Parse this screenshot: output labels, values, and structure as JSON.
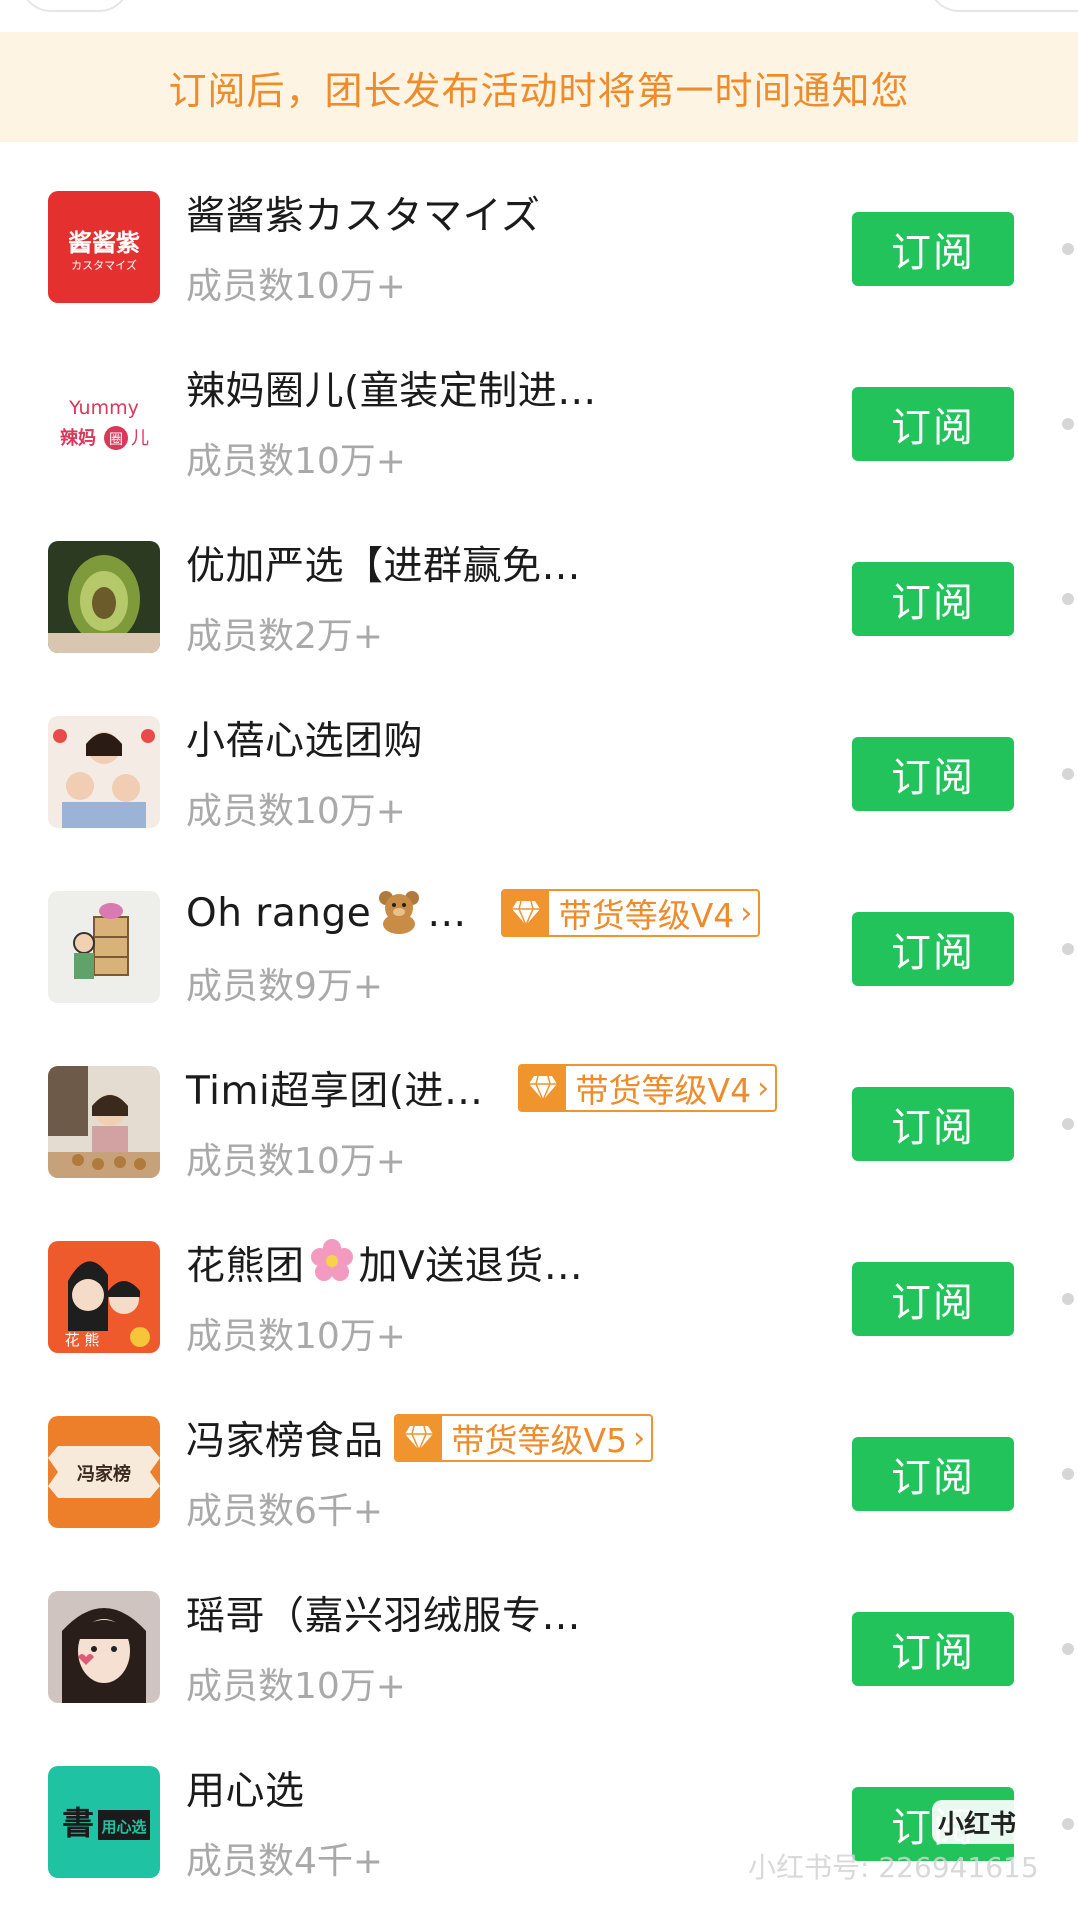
{
  "notice": {
    "text": "订阅后，团长发布活动时将第一时间通知您"
  },
  "groups": [
    {
      "name": "酱酱紫カスタマイズ",
      "members": "成员数10万+",
      "subscribe": "订阅",
      "avatar": "jiangjiangzi-logo",
      "badge": null
    },
    {
      "name": "辣妈圈儿(童装定制进…",
      "members": "成员数10万+",
      "subscribe": "订阅",
      "avatar": "yummy-lamaquaner-logo",
      "badge": null
    },
    {
      "name": "优加严选【进群赢免…",
      "members": "成员数2万+",
      "subscribe": "订阅",
      "avatar": "avocado-carving-photo",
      "badge": null
    },
    {
      "name": "小蓓心选团购",
      "members": "成员数10万+",
      "subscribe": "订阅",
      "avatar": "family-photo",
      "badge": null
    },
    {
      "name_pre": "Oh range",
      "name_post": " …",
      "emoji": "teddy-bear",
      "members": "成员数9万+",
      "subscribe": "订阅",
      "avatar": "delivery-cartoon",
      "badge": "带货等级V4"
    },
    {
      "name": "Timi超享团(进…",
      "members": "成员数10万+",
      "subscribe": "订阅",
      "avatar": "girl-with-cookies-photo",
      "badge": "带货等级V4"
    },
    {
      "name_pre": "花熊团",
      "name_post": "加V送退货…",
      "emoji": "cherry-blossom",
      "members": "成员数10万+",
      "subscribe": "订阅",
      "avatar": "huaxiong-cartoon",
      "badge": null
    },
    {
      "name": "冯家榜食品",
      "members": "成员数6千+",
      "subscribe": "订阅",
      "avatar": "fengjiabang-logo",
      "badge": "带货等级V5"
    },
    {
      "name": "瑶哥（嘉兴羽绒服专…",
      "members": "成员数10万+",
      "subscribe": "订阅",
      "avatar": "girl-portrait-photo",
      "badge": null
    },
    {
      "name": "用心选",
      "members": "成员数4千+",
      "subscribe": "订阅",
      "avatar": "yongxinxuan-logo",
      "badge": null
    }
  ],
  "avatar_text": {
    "jiangjiangzi": "酱酱紫",
    "jiangjiangzi_sub": "カスタマイズ",
    "yummy": "Yummy",
    "lama": "辣妈",
    "quan": "圈",
    "er": "儿",
    "huaxiong": "花 熊",
    "fengjiabang": "冯家榜",
    "shu": "書",
    "yongxin": "用心选"
  },
  "watermark": {
    "text": "小红书号: 226941615",
    "logo": "小红书"
  },
  "colors": {
    "accent_green": "#21c35a",
    "badge_orange": "#f0942e",
    "notice_bg": "#fdf4e3",
    "notice_text": "#ee8b2b"
  }
}
